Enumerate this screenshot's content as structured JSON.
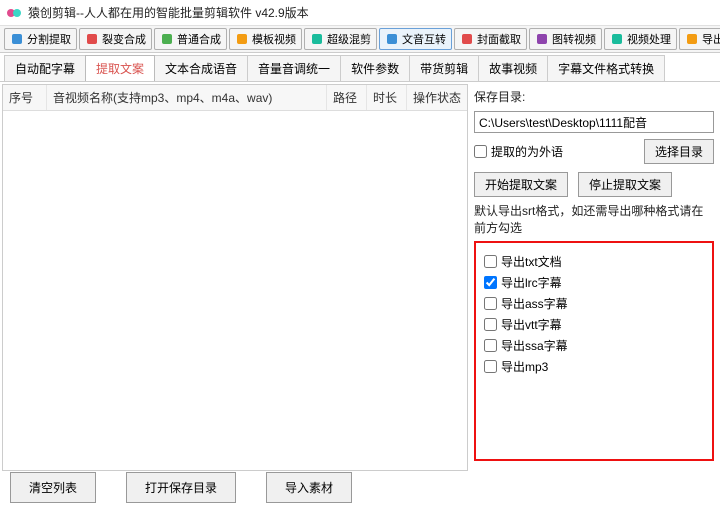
{
  "window": {
    "title": "猿创剪辑--人人都在用的智能批量剪辑软件  v42.9版本"
  },
  "toolbar": [
    {
      "label": "分割提取",
      "icon": "scissors-icon",
      "color": "c-blue"
    },
    {
      "label": "裂变合成",
      "icon": "burst-icon",
      "color": "c-red"
    },
    {
      "label": "普通合成",
      "icon": "play-icon",
      "color": "c-green"
    },
    {
      "label": "模板视频",
      "icon": "template-icon",
      "color": "c-orange"
    },
    {
      "label": "超级混剪",
      "icon": "mix-icon",
      "color": "c-teal"
    },
    {
      "label": "文音互转",
      "icon": "audio-icon",
      "color": "c-blue",
      "active": true
    },
    {
      "label": "封面截取",
      "icon": "crop-icon",
      "color": "c-red"
    },
    {
      "label": "图转视频",
      "icon": "image-icon",
      "color": "c-purple"
    },
    {
      "label": "视频处理",
      "icon": "gear-icon",
      "color": "c-teal"
    },
    {
      "label": "导出标题",
      "icon": "export-icon",
      "color": "c-orange"
    }
  ],
  "subtabs": [
    {
      "label": "自动配字幕"
    },
    {
      "label": "提取文案",
      "active": true
    },
    {
      "label": "文本合成语音"
    },
    {
      "label": "音量音调统一"
    },
    {
      "label": "软件参数"
    },
    {
      "label": "带货剪辑"
    },
    {
      "label": "故事视频"
    },
    {
      "label": "字幕文件格式转换"
    }
  ],
  "list": {
    "headers": {
      "seq": "序号",
      "name": "音视频名称(支持mp3、mp4、m4a、wav)",
      "path": "路径",
      "dur": "时长",
      "status": "操作状态"
    },
    "rows": []
  },
  "side": {
    "save_label": "保存目录:",
    "save_path": "C:\\Users\\test\\Desktop\\1111配音",
    "foreign_label": "提取的为外语",
    "select_dir": "选择目录",
    "start": "开始提取文案",
    "stop": "停止提取文案",
    "note": "默认导出srt格式，如还需导出哪种格式请在前方勾选",
    "checks": [
      {
        "label": "导出txt文档",
        "checked": false
      },
      {
        "label": "导出lrc字幕",
        "checked": true
      },
      {
        "label": "导出ass字幕",
        "checked": false
      },
      {
        "label": "导出vtt字幕",
        "checked": false
      },
      {
        "label": "导出ssa字幕",
        "checked": false
      },
      {
        "label": "导出mp3",
        "checked": false
      }
    ]
  },
  "footer": {
    "clear": "清空列表",
    "open_dir": "打开保存目录",
    "import": "导入素材"
  }
}
